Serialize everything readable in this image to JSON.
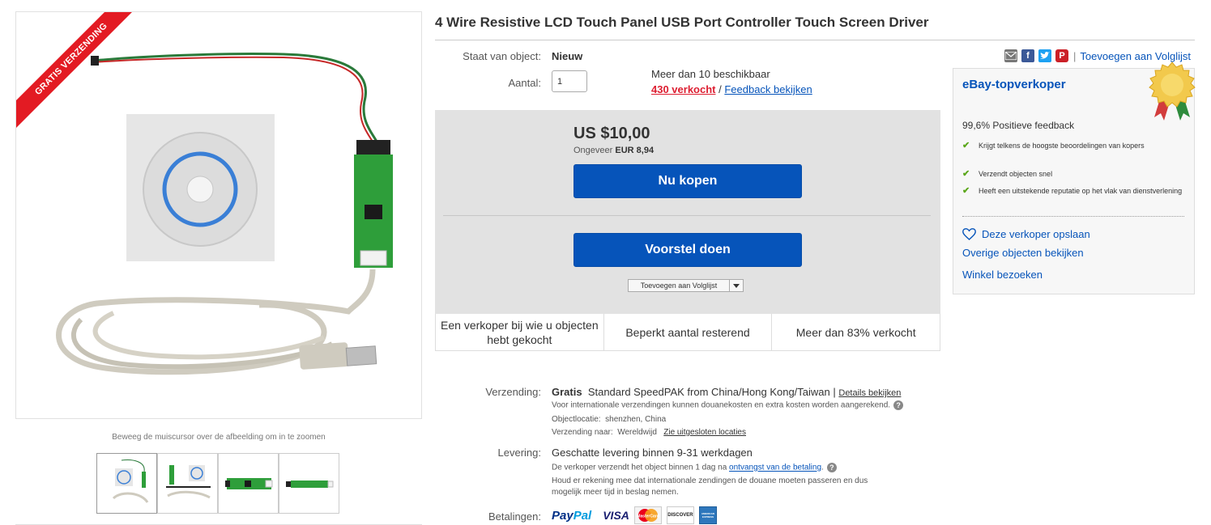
{
  "gallery": {
    "ribbon_text": "GRATIS VERZENDING",
    "zoom_hint": "Beweeg de muiscursor over de afbeelding om in te zoomen",
    "thumbnail_count": 4
  },
  "item": {
    "title": "4 Wire Resistive LCD Touch Panel USB Port Controller Touch Screen Driver",
    "condition_label": "Staat van object:",
    "condition_value": "Nieuw",
    "quantity_label": "Aantal:",
    "quantity_value": "1",
    "available": "Meer dan 10 beschikbaar",
    "sold": "430 verkocht",
    "sold_separator": " / ",
    "feedback_link": "Feedback bekijken"
  },
  "buy_box": {
    "price": "US $10,00",
    "approx_prefix": "Ongeveer",
    "approx_value": "EUR 8,94",
    "buy_now": "Nu kopen",
    "make_offer": "Voorstel doen",
    "add_watchlist": "Toevoegen aan Volglijst"
  },
  "trust_bar": [
    "Een verkoper bij wie u objecten hebt gekocht",
    "Beperkt aantal resterend",
    "Meer dan 83% verkocht"
  ],
  "shipping": {
    "label": "Verzending:",
    "free": "Gratis",
    "method": "Standard SpeedPAK from China/Hong Kong/Taiwan",
    "separator": " | ",
    "details_link": "Details bekijken",
    "customs_note": "Voor internationale verzendingen kunnen douanekosten en extra kosten worden aangerekend.",
    "location_label": "Objectlocatie:",
    "location_value": "shenzhen, China",
    "ships_to_label": "Verzending naar:",
    "ships_to_value": "Wereldwijd",
    "excluded_link": "Zie uitgesloten locaties"
  },
  "delivery": {
    "label": "Levering:",
    "estimate": "Geschatte levering binnen 9-31 werkdagen",
    "dispatch_text": "De verkoper verzendt het object binnen 1 dag na",
    "payment_link": "ontvangst van de betaling",
    "customs_line1": "Houd er rekening mee dat internationale zendingen de douane moeten passeren en dus",
    "customs_line2": "mogelijk meer tijd in beslag nemen."
  },
  "payments": {
    "label": "Betalingen:",
    "paypal": "PayPal",
    "visa": "VISA",
    "mastercard": "MasterCard",
    "discover": "DISCOVER",
    "amex": "AMERICAN EXPRESS"
  },
  "share": {
    "watchlist_link": "Toevoegen aan Volglijst",
    "separator": "|"
  },
  "seller": {
    "title": "eBay-topverkoper",
    "positive_feedback": "99,6% Positieve feedback",
    "perks": [
      "Krijgt telkens de hoogste beoordelingen van kopers",
      "Verzendt objecten snel",
      "Heeft een uitstekende reputatie op het vlak van dienstverlening"
    ],
    "save_seller": "Deze verkoper opslaan",
    "other_items": "Overige objecten bekijken",
    "visit_store": "Winkel bezoeken"
  },
  "colors": {
    "ebay_blue": "#0654ba",
    "sold_red": "#dd1e31",
    "ribbon_red": "#e31b23",
    "buy_box_bg": "#e2e2e2",
    "check_green": "#5ba71b"
  }
}
